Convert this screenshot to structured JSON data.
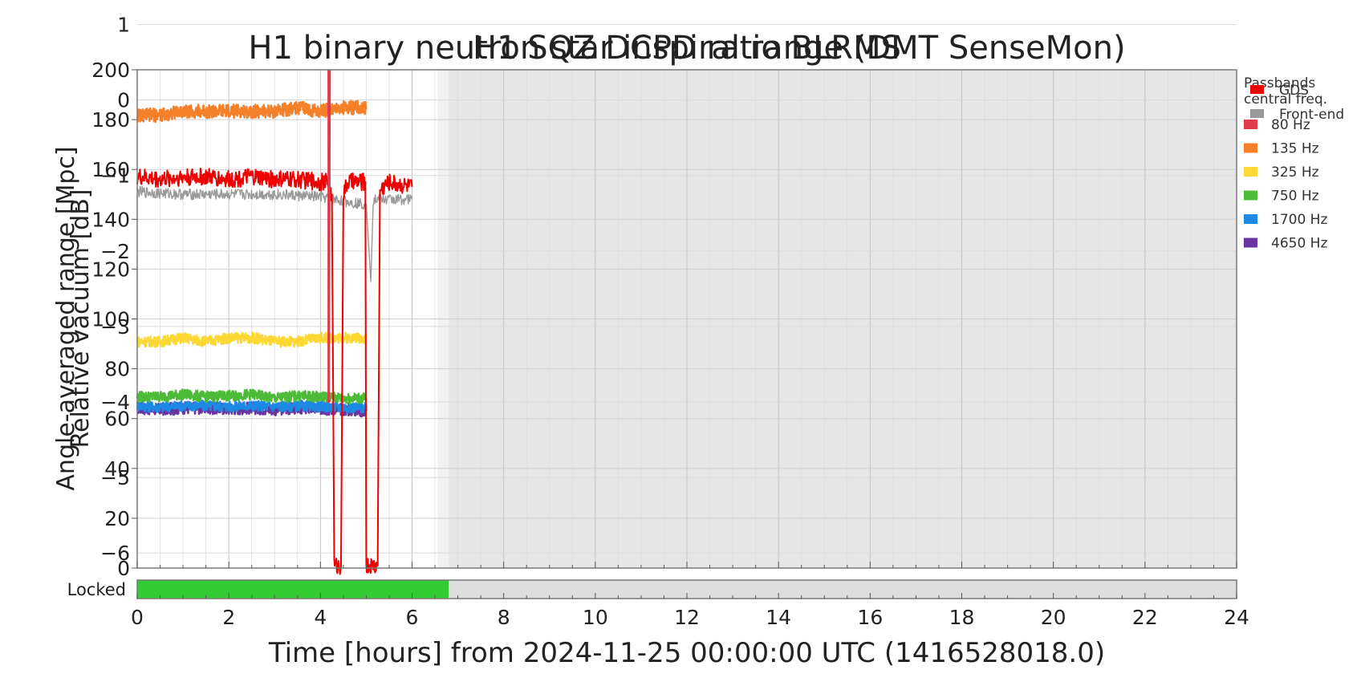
{
  "chart_data": {
    "type": "line",
    "titles": [
      "H1 binary neutron star inspiral range (DMT SenseMon)",
      "H1 SQZ DCPD ratio BLRMS"
    ],
    "xlabel": "Time [hours] from 2024-11-25 00:00:00 UTC (1416528018.0)",
    "ylabel_left": "Angle-averaged range [Mpc]",
    "ylabel_right": "Relative vacuum [dB]",
    "xlim": [
      0,
      24
    ],
    "ylim_range": [
      0,
      200
    ],
    "ylim_db": [
      -6.2,
      0.4
    ],
    "x_ticks": [
      "0",
      "2",
      "4",
      "6",
      "8",
      "10",
      "12",
      "14",
      "16",
      "18",
      "20",
      "22",
      "24"
    ],
    "range_ticks": [
      "0",
      "20",
      "40",
      "60",
      "80",
      "100",
      "120",
      "140",
      "160",
      "180",
      "200"
    ],
    "db_ticks": [
      "-6",
      "-5",
      "-4",
      "-3",
      "-2",
      "-1",
      "0",
      "1"
    ],
    "grid": true,
    "unlocked_region": [
      6.8,
      24
    ],
    "legend": {
      "placement": "outside-right",
      "title": "Passbands\ncentral freq.",
      "range_entries": [
        {
          "name": "GDS",
          "color": "#ee0000"
        },
        {
          "name": "Front-end",
          "color": "#999999"
        }
      ],
      "blrms_entries": [
        {
          "name": "80 Hz",
          "color": "#e03a4e"
        },
        {
          "name": "135 Hz",
          "color": "#f5802a"
        },
        {
          "name": "325 Hz",
          "color": "#fdd835"
        },
        {
          "name": "750 Hz",
          "color": "#4cbb38"
        },
        {
          "name": "1700 Hz",
          "color": "#1e88e5"
        },
        {
          "name": "4650 Hz",
          "color": "#6a35a0"
        }
      ]
    },
    "series": [
      {
        "name": "GDS",
        "axis": "range",
        "color": "#ee0000",
        "points": [
          [
            0,
            157
          ],
          [
            0.5,
            156
          ],
          [
            1,
            157
          ],
          [
            1.5,
            157
          ],
          [
            2,
            156
          ],
          [
            2.5,
            157
          ],
          [
            3,
            156
          ],
          [
            3.5,
            156
          ],
          [
            4,
            155
          ],
          [
            4.15,
            155
          ],
          [
            4.25,
            150
          ],
          [
            4.3,
            4
          ],
          [
            4.3,
            1
          ],
          [
            4.45,
            1
          ],
          [
            4.45,
            4
          ],
          [
            4.5,
            150
          ],
          [
            4.6,
            155
          ],
          [
            4.9,
            155
          ],
          [
            4.98,
            155
          ],
          [
            5.0,
            4
          ],
          [
            5.0,
            1
          ],
          [
            5.25,
            1
          ],
          [
            5.25,
            4
          ],
          [
            5.3,
            152
          ],
          [
            5.5,
            155
          ],
          [
            6.0,
            153
          ]
        ]
      },
      {
        "name": "Front-end",
        "axis": "range",
        "color": "#999999",
        "points": [
          [
            0,
            151
          ],
          [
            1,
            150
          ],
          [
            2,
            150
          ],
          [
            3,
            150
          ],
          [
            4,
            149
          ],
          [
            4.6,
            147
          ],
          [
            5,
            146
          ],
          [
            5.1,
            115
          ],
          [
            5.15,
            148
          ],
          [
            6.0,
            148
          ]
        ]
      },
      {
        "name": "135 Hz",
        "axis": "db",
        "color": "#f5802a",
        "points": [
          [
            0,
            -0.2
          ],
          [
            0.5,
            -0.2
          ],
          [
            1,
            -0.15
          ],
          [
            1.5,
            -0.15
          ],
          [
            2,
            -0.15
          ],
          [
            2.5,
            -0.15
          ],
          [
            3,
            -0.15
          ],
          [
            3.5,
            -0.1
          ],
          [
            4,
            -0.15
          ],
          [
            4.5,
            -0.1
          ],
          [
            5,
            -0.1
          ]
        ]
      },
      {
        "name": "325 Hz",
        "axis": "db",
        "color": "#fdd835",
        "points": [
          [
            0,
            -3.2
          ],
          [
            0.5,
            -3.2
          ],
          [
            1,
            -3.15
          ],
          [
            1.5,
            -3.2
          ],
          [
            2,
            -3.15
          ],
          [
            2.5,
            -3.15
          ],
          [
            3,
            -3.2
          ],
          [
            3.5,
            -3.2
          ],
          [
            4,
            -3.15
          ],
          [
            4.5,
            -3.15
          ],
          [
            5,
            -3.15
          ]
        ]
      },
      {
        "name": "750 Hz",
        "axis": "db",
        "color": "#4cbb38",
        "points": [
          [
            0,
            -3.93
          ],
          [
            0.5,
            -3.93
          ],
          [
            1,
            -3.9
          ],
          [
            1.5,
            -3.93
          ],
          [
            2,
            -3.92
          ],
          [
            2.5,
            -3.9
          ],
          [
            3,
            -3.95
          ],
          [
            3.5,
            -3.92
          ],
          [
            4,
            -3.93
          ],
          [
            4.5,
            -3.95
          ],
          [
            5,
            -3.95
          ]
        ]
      },
      {
        "name": "1700 Hz",
        "axis": "db",
        "color": "#1e88e5",
        "points": [
          [
            0,
            -4.05
          ],
          [
            0.5,
            -4.07
          ],
          [
            1,
            -4.05
          ],
          [
            1.5,
            -4.05
          ],
          [
            2,
            -4.06
          ],
          [
            2.5,
            -4.05
          ],
          [
            3,
            -4.06
          ],
          [
            3.5,
            -4.05
          ],
          [
            4,
            -4.06
          ],
          [
            4.5,
            -4.07
          ],
          [
            5,
            -4.08
          ]
        ]
      },
      {
        "name": "4650 Hz",
        "axis": "db",
        "color": "#6a35a0",
        "points": [
          [
            0,
            -4.08
          ],
          [
            0.5,
            -4.1
          ],
          [
            1,
            -4.08
          ],
          [
            1.5,
            -4.08
          ],
          [
            2,
            -4.09
          ],
          [
            2.5,
            -4.08
          ],
          [
            3,
            -4.1
          ],
          [
            3.5,
            -4.08
          ],
          [
            4,
            -4.09
          ],
          [
            4.5,
            -4.1
          ],
          [
            5,
            -4.12
          ]
        ]
      },
      {
        "name": "80 Hz",
        "axis": "db",
        "color": "#e03a4e",
        "points": [
          [
            4.18,
            0.4
          ],
          [
            4.18,
            -4.0
          ],
          [
            4.2,
            0.4
          ]
        ]
      }
    ],
    "state_bar": {
      "label": "Locked",
      "segments": [
        {
          "start": 0,
          "end": 6.8,
          "color": "#33cc33"
        },
        {
          "start": 6.8,
          "end": 24,
          "color": "#dddddd"
        }
      ]
    }
  }
}
